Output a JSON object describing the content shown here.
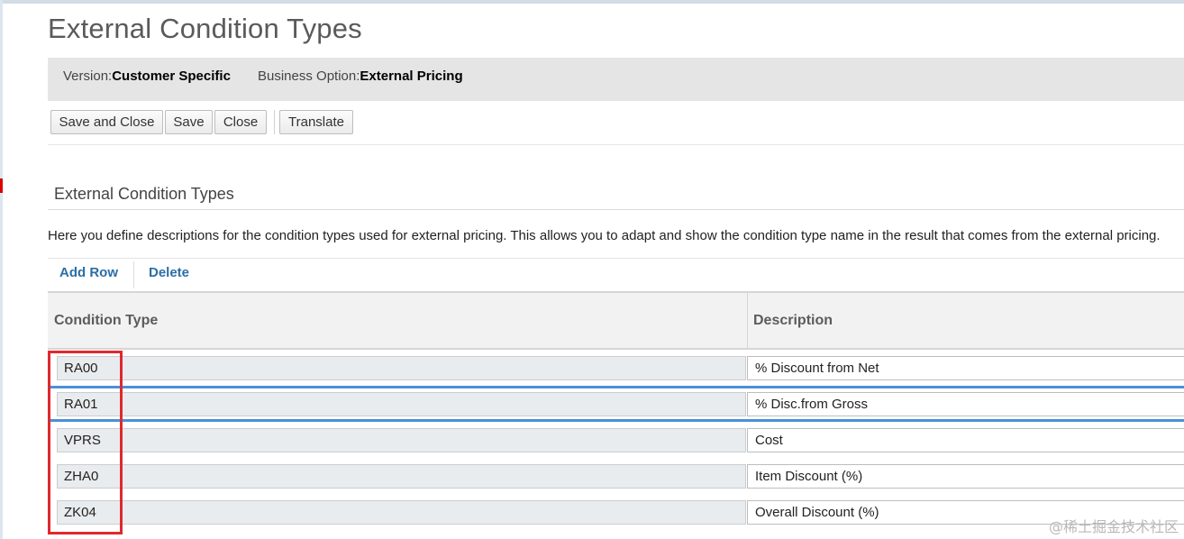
{
  "page": {
    "title": "External Condition Types"
  },
  "info_bar": {
    "version_label": "Version:",
    "version_value": "Customer Specific",
    "business_option_label": "Business Option:",
    "business_option_value": "External Pricing"
  },
  "toolbar": {
    "save_and_close_label": "Save and Close",
    "save_label": "Save",
    "close_label": "Close",
    "translate_label": "Translate"
  },
  "section": {
    "title": "External Condition Types",
    "description": "Here you define descriptions for the condition types used for external pricing. This allows you to adapt and show the condition type name in the result that comes from the external pricing."
  },
  "table_actions": {
    "add_row_label": "Add Row",
    "delete_label": "Delete"
  },
  "table": {
    "columns": [
      "Condition Type",
      "Description"
    ],
    "rows": [
      {
        "condition_type": "RA00",
        "description": "% Discount from Net"
      },
      {
        "condition_type": "RA01",
        "description": "% Disc.from Gross"
      },
      {
        "condition_type": "VPRS",
        "description": "Cost"
      },
      {
        "condition_type": "ZHA0",
        "description": "Item Discount (%)"
      },
      {
        "condition_type": "ZK04",
        "description": "Overall Discount (%)"
      }
    ],
    "selected_row": 1
  },
  "watermark": "@稀土掘金技术社区",
  "colors": {
    "link": "#2a6ea6",
    "selection": "#4a90d9",
    "highlight_box": "#e0292e",
    "info_bar_bg": "#e5e5e5"
  }
}
